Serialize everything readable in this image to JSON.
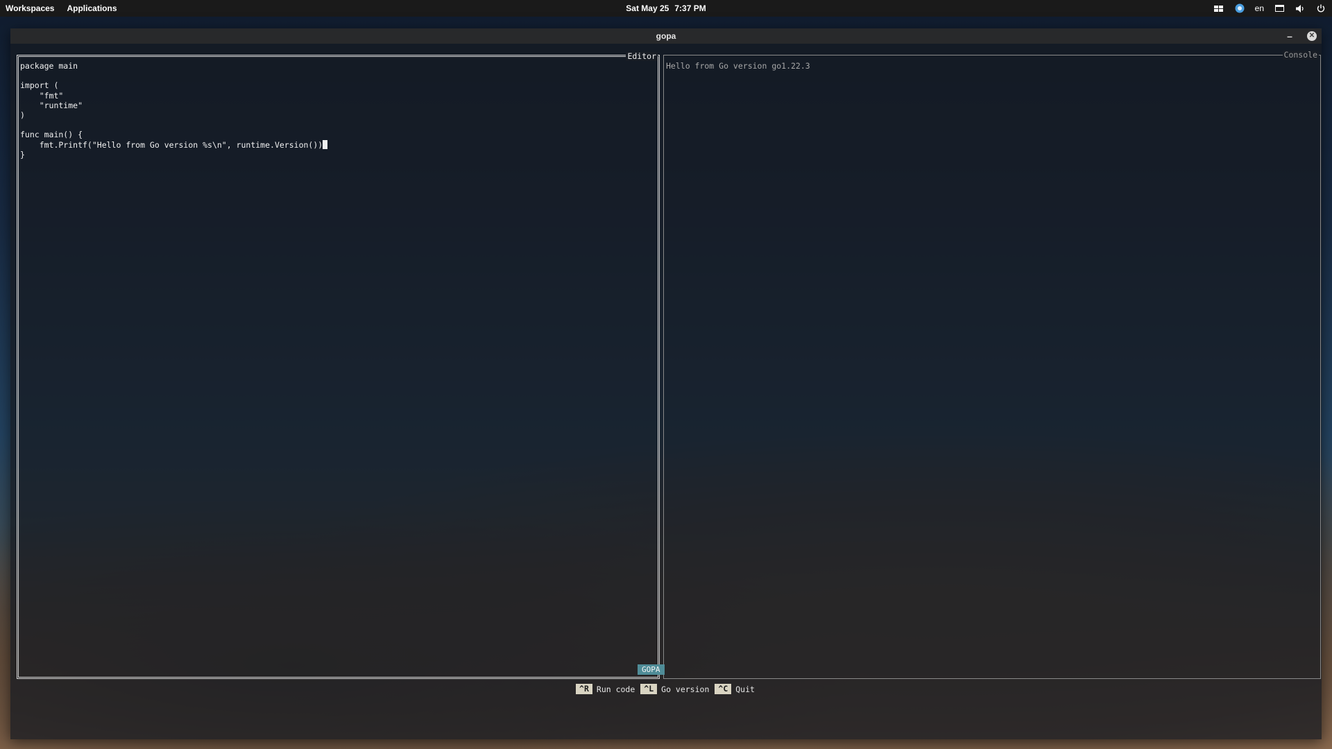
{
  "top_panel": {
    "workspaces_label": "Workspaces",
    "applications_label": "Applications",
    "date": "Sat May 25",
    "time": "7:37 PM",
    "language": "en",
    "tray_icons": [
      "window-switcher-icon",
      "chat-icon",
      "display-icon",
      "volume-icon",
      "power-icon"
    ]
  },
  "window": {
    "title": "gopa"
  },
  "editor": {
    "title": "Editor",
    "code": "package main\n\nimport (\n    \"fmt\"\n    \"runtime\"\n)\n\nfunc main() {\n    fmt.Printf(\"Hello from Go version %s\\n\", runtime.Version())",
    "code_after_cursor": "\n}"
  },
  "console": {
    "title": "Console",
    "output": "Hello from Go version go1.22.3"
  },
  "status": {
    "app_name": "GOPA"
  },
  "shortcuts": [
    {
      "key": "^R",
      "label": "Run code"
    },
    {
      "key": "^L",
      "label": "Go version"
    },
    {
      "key": "^C",
      "label": "Quit"
    }
  ],
  "colors": {
    "badge": "#4f8c97",
    "key_bg": "#d9d4c2"
  }
}
